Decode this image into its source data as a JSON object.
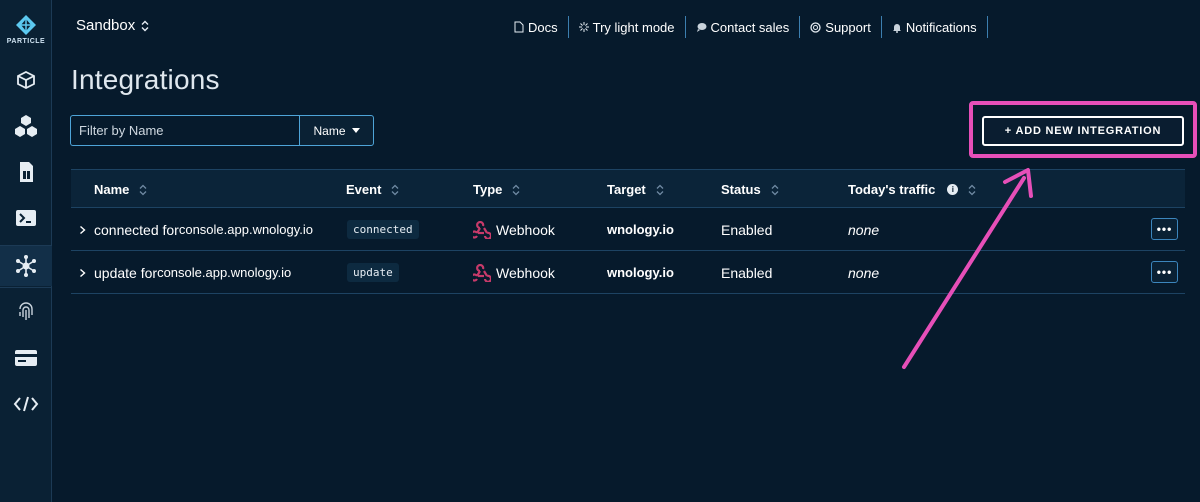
{
  "sidebar": {
    "logo_text": "PARTICLE",
    "items": [
      {
        "name": "products-icon",
        "active": false
      },
      {
        "name": "fleet-icon",
        "active": false
      },
      {
        "name": "sim-card-icon",
        "active": false
      },
      {
        "name": "terminal-icon",
        "active": false
      },
      {
        "name": "integrations-icon",
        "active": true
      },
      {
        "name": "fingerprint-icon",
        "active": false
      },
      {
        "name": "billing-card-icon",
        "active": false
      },
      {
        "name": "code-icon",
        "active": false
      }
    ]
  },
  "header": {
    "org_name": "Sandbox",
    "nav": [
      {
        "label": "Docs",
        "icon": "doc-icon"
      },
      {
        "label": "Try light mode",
        "icon": "sun-icon"
      },
      {
        "label": "Contact sales",
        "icon": "chat-icon"
      },
      {
        "label": "Support",
        "icon": "lifebuoy-icon"
      },
      {
        "label": "Notifications",
        "icon": "bell-icon"
      }
    ]
  },
  "page": {
    "title": "Integrations",
    "filter_placeholder": "Filter by Name",
    "filter_select_value": "Name",
    "add_button_label": "+ ADD NEW INTEGRATION"
  },
  "table": {
    "columns": [
      "Name",
      "Event",
      "Type",
      "Target",
      "Status",
      "Today's traffic"
    ],
    "rows": [
      {
        "name_prefix": "connected for ",
        "name_host": "console.app.wnology.io",
        "event": "connected",
        "type": "Webhook",
        "target": "wnology.io",
        "status": "Enabled",
        "traffic": "none"
      },
      {
        "name_prefix": "update for ",
        "name_host": "console.app.wnology.io",
        "event": "update",
        "type": "Webhook",
        "target": "wnology.io",
        "status": "Enabled",
        "traffic": "none"
      }
    ],
    "more_label": "•••"
  },
  "colors": {
    "background": "#061a2c",
    "accent_border": "#4ea4d8",
    "highlight": "#e64fb8",
    "webhook": "#c73a6a"
  }
}
